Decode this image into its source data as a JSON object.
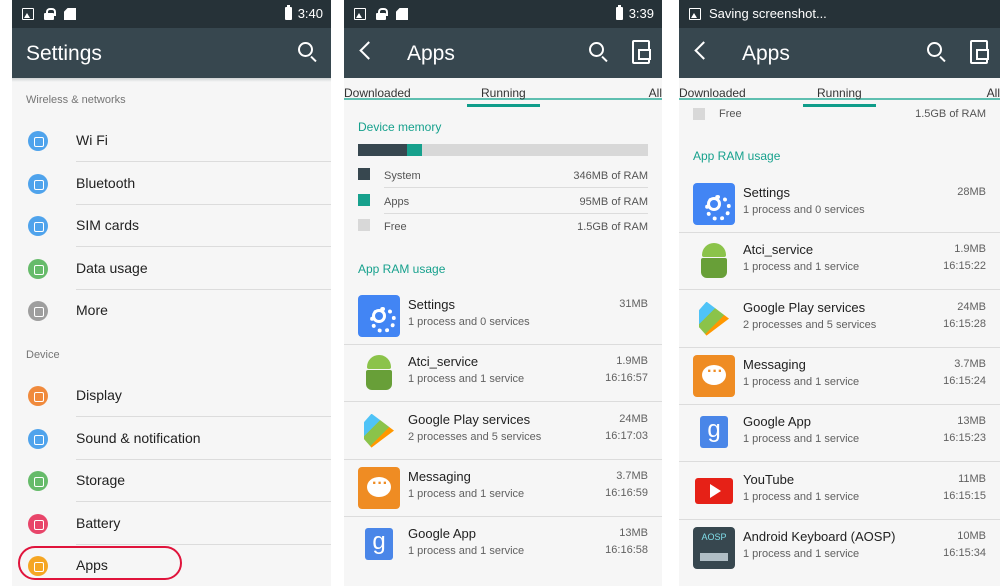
{
  "screen1": {
    "status_time": "3:40",
    "title": "Settings",
    "section_wireless": "Wireless & networks",
    "section_device": "Device",
    "wireless_items": [
      {
        "label": "Wi Fi",
        "icon": "wifi-icon",
        "color": "#4fa3ec"
      },
      {
        "label": "Bluetooth",
        "icon": "bluetooth-icon",
        "color": "#4fa3ec"
      },
      {
        "label": "SIM cards",
        "icon": "sim-card-icon",
        "color": "#4fa3ec"
      },
      {
        "label": "Data usage",
        "icon": "data-usage-icon",
        "color": "#66bb6a"
      },
      {
        "label": "More",
        "icon": "more-icon",
        "color": "#9e9e9e"
      }
    ],
    "device_items": [
      {
        "label": "Display",
        "icon": "display-icon",
        "color": "#f08a3c"
      },
      {
        "label": "Sound & notification",
        "icon": "sound-icon",
        "color": "#4fa3ec"
      },
      {
        "label": "Storage",
        "icon": "storage-icon",
        "color": "#66bb6a"
      },
      {
        "label": "Battery",
        "icon": "battery-icon",
        "color": "#e8456a"
      },
      {
        "label": "Apps",
        "icon": "apps-icon",
        "color": "#f5a623"
      }
    ],
    "highlight_color": "#e0143c"
  },
  "screen2": {
    "status_time": "3:39",
    "title": "Apps",
    "tabs": [
      "Downloaded",
      "Running",
      "All"
    ],
    "device_memory_label": "Device memory",
    "memory": [
      {
        "name": "System",
        "value": "346MB of RAM",
        "color": "#37474f",
        "fraction": 0.17
      },
      {
        "name": "Apps",
        "value": "95MB of RAM",
        "color": "#17a18d",
        "fraction": 0.05
      },
      {
        "name": "Free",
        "value": "1.5GB of RAM",
        "color": "#d8d8d8",
        "fraction": 0.78
      }
    ],
    "app_ram_label": "App RAM usage",
    "apps": [
      {
        "name": "Settings",
        "sub": "1 process and 0 services",
        "mem": "31MB",
        "time": "",
        "icon": "settings"
      },
      {
        "name": "Atci_service",
        "sub": "1 process and 1 service",
        "mem": "1.9MB",
        "time": "16:16:57",
        "icon": "android"
      },
      {
        "name": "Google Play services",
        "sub": "2 processes and 5 services",
        "mem": "24MB",
        "time": "16:17:03",
        "icon": "play"
      },
      {
        "name": "Messaging",
        "sub": "1 process and 1 service",
        "mem": "3.7MB",
        "time": "16:16:59",
        "icon": "messaging"
      },
      {
        "name": "Google App",
        "sub": "1 process and 1 service",
        "mem": "13MB",
        "time": "16:16:58",
        "icon": "google"
      }
    ]
  },
  "screen3": {
    "status_text": "Saving screenshot...",
    "title": "Apps",
    "tabs": [
      "Downloaded",
      "Running",
      "All"
    ],
    "free_label": "Free",
    "free_value": "1.5GB of RAM",
    "app_ram_label": "App RAM usage",
    "apps": [
      {
        "name": "Settings",
        "sub": "1 process and 0 services",
        "mem": "28MB",
        "time": "",
        "icon": "settings"
      },
      {
        "name": "Atci_service",
        "sub": "1 process and 1 service",
        "mem": "1.9MB",
        "time": "16:15:22",
        "icon": "android"
      },
      {
        "name": "Google Play services",
        "sub": "2 processes and 5 services",
        "mem": "24MB",
        "time": "16:15:28",
        "icon": "play"
      },
      {
        "name": "Messaging",
        "sub": "1 process and 1 service",
        "mem": "3.7MB",
        "time": "16:15:24",
        "icon": "messaging"
      },
      {
        "name": "Google App",
        "sub": "1 process and 1 service",
        "mem": "13MB",
        "time": "16:15:23",
        "icon": "google"
      },
      {
        "name": "YouTube",
        "sub": "1 process and 1 service",
        "mem": "11MB",
        "time": "16:15:15",
        "icon": "youtube"
      },
      {
        "name": "Android Keyboard (AOSP)",
        "sub": "1 process and 1 service",
        "mem": "10MB",
        "time": "16:15:34",
        "icon": "keyboard"
      }
    ]
  }
}
